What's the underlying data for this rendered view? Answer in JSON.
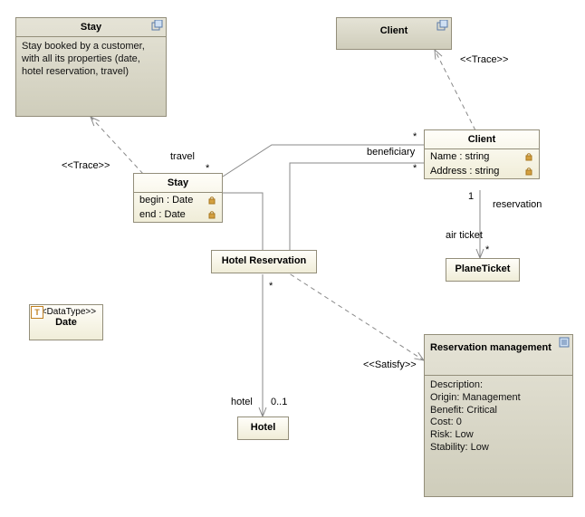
{
  "notes": {
    "stay": {
      "title": "Stay",
      "body": "Stay booked by a customer, with all its properties (date, hotel reservation, travel)"
    },
    "client": {
      "title": "Client"
    },
    "reservation_mgmt": {
      "title": "Reservation management",
      "body_lines": [
        "Description:",
        "Origin: Management",
        "Benefit: Critical",
        "Cost: 0",
        "Risk: Low",
        "Stability: Low"
      ]
    }
  },
  "classes": {
    "stay": {
      "name": "Stay",
      "attrs": [
        {
          "text": "begin : Date"
        },
        {
          "text": "end : Date"
        }
      ]
    },
    "client": {
      "name": "Client",
      "attrs": [
        {
          "text": "Name : string"
        },
        {
          "text": "Address : string"
        }
      ]
    },
    "hotel_reservation": {
      "name": "Hotel Reservation"
    },
    "plane_ticket": {
      "name": "PlaneTicket"
    },
    "hotel": {
      "name": "Hotel"
    },
    "date": {
      "stereotype": "<<DataType>>",
      "name": "Date"
    }
  },
  "labels": {
    "trace1": "<<Trace>>",
    "trace2": "<<Trace>>",
    "satisfy": "<<Satisfy>>",
    "travel": "travel",
    "beneficiary": "beneficiary",
    "reservation": "reservation",
    "air_ticket": "air ticket",
    "hotel": "hotel",
    "m_star1": "*",
    "m_star2": "*",
    "m_star3": "*",
    "m_star4": "*",
    "m_star5": "*",
    "m_one": "1",
    "m_zo": "0..1",
    "type_T": "T"
  }
}
